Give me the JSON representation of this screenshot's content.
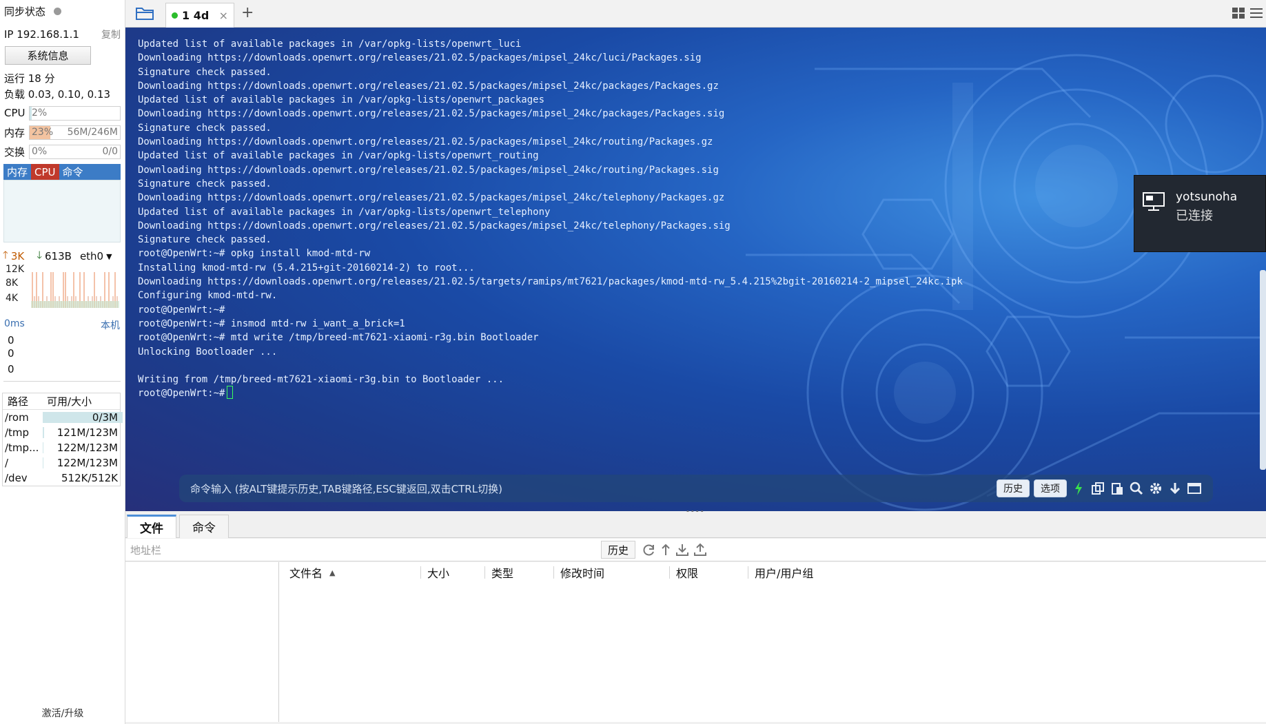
{
  "sidebar": {
    "sync_label": "同步状态",
    "ip": "IP 192.168.1.1",
    "copy": "复制",
    "sysinfo_button": "系统信息",
    "uptime": "运行 18 分",
    "load": "负载 0.03, 0.10, 0.13",
    "cpu": {
      "label": "CPU",
      "percent_text": "2%",
      "fraction": 0.02
    },
    "mem": {
      "label": "内存",
      "percent_text": "23%",
      "detail": "56M/246M",
      "fraction": 0.23
    },
    "swap": {
      "label": "交换",
      "percent_text": "0%",
      "detail": "0/0",
      "fraction": 0.0
    },
    "graph_tabs": [
      "内存",
      "CPU",
      "命令"
    ],
    "net": {
      "up": "3K",
      "down": "613B",
      "iface": "eth0",
      "axis": [
        "12K",
        "8K",
        "4K"
      ]
    },
    "ping": {
      "ms": "0ms",
      "local": "本机",
      "values": [
        "0",
        "0",
        "0"
      ]
    },
    "disk": {
      "headers": [
        "路径",
        "可用/大小"
      ],
      "rows": [
        {
          "path": "/rom",
          "size": "0/3M",
          "used_fraction": 1.0
        },
        {
          "path": "/tmp",
          "size": "121M/123M",
          "used_fraction": 0.02
        },
        {
          "path": "/tmp...",
          "size": "122M/123M",
          "used_fraction": 0.01
        },
        {
          "path": "/",
          "size": "122M/123M",
          "used_fraction": 0.01
        },
        {
          "path": "/dev",
          "size": "512K/512K",
          "used_fraction": 0.0
        }
      ]
    },
    "activate": "激活/升级"
  },
  "tabbar": {
    "tab_label": "1 4d",
    "close": "×",
    "add": "+"
  },
  "terminal": {
    "lines": [
      "Updated list of available packages in /var/opkg-lists/openwrt_luci",
      "Downloading https://downloads.openwrt.org/releases/21.02.5/packages/mipsel_24kc/luci/Packages.sig",
      "Signature check passed.",
      "Downloading https://downloads.openwrt.org/releases/21.02.5/packages/mipsel_24kc/packages/Packages.gz",
      "Updated list of available packages in /var/opkg-lists/openwrt_packages",
      "Downloading https://downloads.openwrt.org/releases/21.02.5/packages/mipsel_24kc/packages/Packages.sig",
      "Signature check passed.",
      "Downloading https://downloads.openwrt.org/releases/21.02.5/packages/mipsel_24kc/routing/Packages.gz",
      "Updated list of available packages in /var/opkg-lists/openwrt_routing",
      "Downloading https://downloads.openwrt.org/releases/21.02.5/packages/mipsel_24kc/routing/Packages.sig",
      "Signature check passed.",
      "Downloading https://downloads.openwrt.org/releases/21.02.5/packages/mipsel_24kc/telephony/Packages.gz",
      "Updated list of available packages in /var/opkg-lists/openwrt_telephony",
      "Downloading https://downloads.openwrt.org/releases/21.02.5/packages/mipsel_24kc/telephony/Packages.sig",
      "Signature check passed.",
      "root@OpenWrt:~# opkg install kmod-mtd-rw",
      "Installing kmod-mtd-rw (5.4.215+git-20160214-2) to root...",
      "Downloading https://downloads.openwrt.org/releases/21.02.5/targets/ramips/mt7621/packages/kmod-mtd-rw_5.4.215%2bgit-20160214-2_mipsel_24kc.ipk",
      "Configuring kmod-mtd-rw.",
      "root@OpenWrt:~#",
      "root@OpenWrt:~# insmod mtd-rw i_want_a_brick=1",
      "root@OpenWrt:~# mtd write /tmp/breed-mt7621-xiaomi-r3g.bin Bootloader",
      "Unlocking Bootloader ...",
      "",
      "Writing from /tmp/breed-mt7621-xiaomi-r3g.bin to Bootloader ...",
      "root@OpenWrt:~#"
    ],
    "command_placeholder": "命令输入 (按ALT键提示历史,TAB键路径,ESC键返回,双击CTRL切换)",
    "history_button": "历史",
    "options_button": "选项"
  },
  "toast": {
    "name": "yotsunoha",
    "status": "已连接"
  },
  "files": {
    "tabs": [
      "文件",
      "命令"
    ],
    "address_placeholder": "地址栏",
    "history_button": "历史",
    "columns": [
      "文件名",
      "大小",
      "类型",
      "修改时间",
      "权限",
      "用户/用户组"
    ]
  },
  "colors": {
    "accent": "#3c7cc6",
    "cpu_tab": "#c0392b",
    "mem_fill": "#f3c3a0",
    "terminal_text": "#e6f0ff",
    "cursor": "#3cff5c"
  }
}
